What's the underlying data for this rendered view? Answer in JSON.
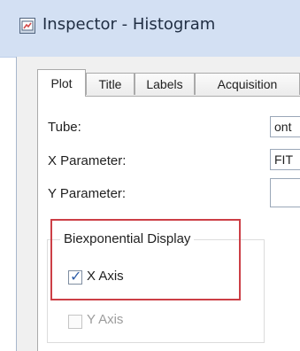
{
  "window": {
    "title": "Inspector - Histogram",
    "icon": "inspector-icon"
  },
  "tabs": [
    {
      "label": "Plot",
      "active": true
    },
    {
      "label": "Title",
      "active": false
    },
    {
      "label": "Labels",
      "active": false
    },
    {
      "label": "Acquisition",
      "active": false
    }
  ],
  "fields": {
    "tube": {
      "label": "Tube:",
      "value": "ont"
    },
    "x_parameter": {
      "label": "X Parameter:",
      "value": "FIT"
    },
    "y_parameter": {
      "label": "Y Parameter:",
      "value": ""
    }
  },
  "biexponential_display": {
    "title": "Biexponential Display",
    "x_axis": {
      "label": "X Axis",
      "checked": true,
      "enabled": true
    },
    "y_axis": {
      "label": "Y Axis",
      "checked": false,
      "enabled": false
    }
  },
  "colors": {
    "highlight": "#cc3f46",
    "titlebar": "#d3e0f3",
    "dialog_background": "#f0f0f0"
  }
}
